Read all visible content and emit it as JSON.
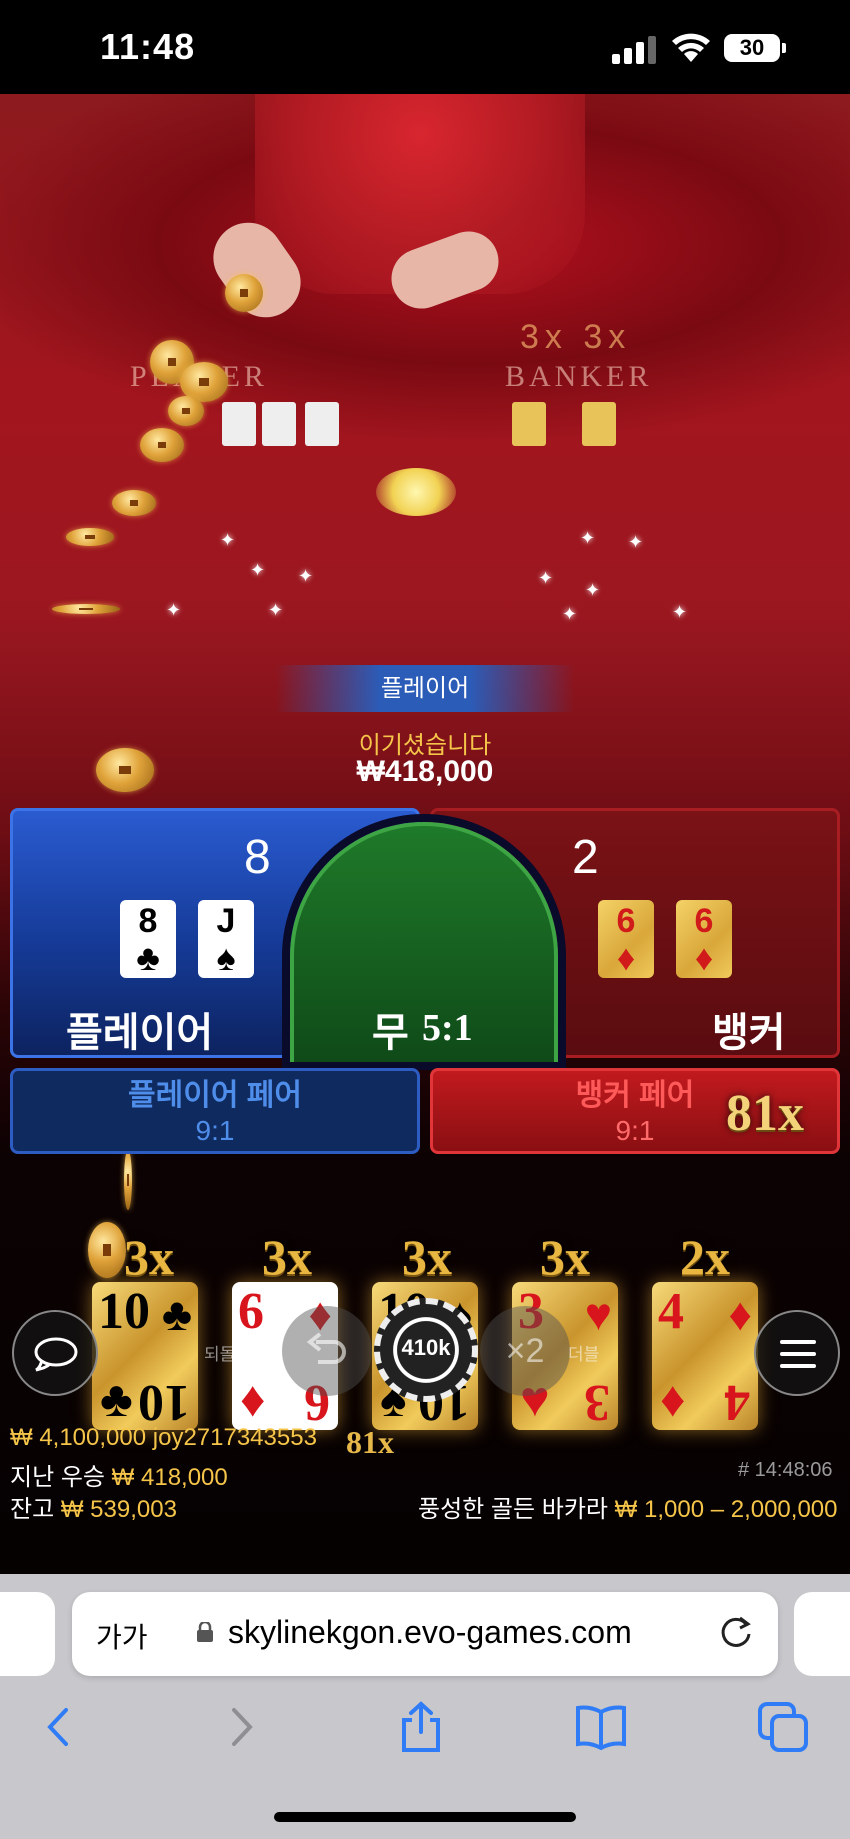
{
  "status_bar": {
    "time": "11:48",
    "battery": "30"
  },
  "table": {
    "player_text": "PLAYER",
    "banker_text": "BANKER",
    "multipliers": "3x 3x"
  },
  "result": {
    "winner": "플레이어",
    "message": "이기셨습니다",
    "amount": "₩418,000"
  },
  "board": {
    "player": {
      "label": "플레이어",
      "score": "8",
      "cards": [
        {
          "rank": "8",
          "suit": "♣"
        },
        {
          "rank": "J",
          "suit": "♠"
        }
      ]
    },
    "banker": {
      "label": "뱅커",
      "score": "2",
      "cards": [
        {
          "rank": "6",
          "suit": "♦"
        },
        {
          "rank": "6",
          "suit": "♦"
        }
      ]
    },
    "tie": {
      "label": "무",
      "odds": "5:1"
    },
    "player_pair": {
      "label": "플레이어 페어",
      "odds": "9:1"
    },
    "banker_pair": {
      "label": "뱅커 페어",
      "odds": "9:1",
      "multiplier": "81x"
    }
  },
  "golden_cards": [
    {
      "multiplier": "3x",
      "rank": "10",
      "suit": "♣",
      "color": "black",
      "style": "gold"
    },
    {
      "multiplier": "3x",
      "rank": "6",
      "suit": "♦",
      "color": "red",
      "style": "white"
    },
    {
      "multiplier": "3x",
      "rank": "10",
      "suit": "♠",
      "color": "black",
      "style": "gold"
    },
    {
      "multiplier": "3x",
      "rank": "3",
      "suit": "♥",
      "color": "red",
      "style": "gold"
    },
    {
      "multiplier": "2x",
      "rank": "4",
      "suit": "♦",
      "color": "red",
      "style": "gold"
    }
  ],
  "controls": {
    "undo_label": "되돌리기",
    "chip_value": "410k",
    "double_label": "더블",
    "double_text": "×2"
  },
  "info": {
    "top_winner": "₩ 4,100,000 joy2717343553",
    "top_winner_multiplier": "81x",
    "last_win_label": "지난 우승",
    "last_win_value": "₩ 418,000",
    "balance_label": "잔고",
    "balance_value": "₩ 539,003",
    "round_id": "# 14:48:06",
    "table_name": "풍성한 골든 바카라",
    "table_limits": "₩ 1,000 – 2,000,000"
  },
  "browser": {
    "aa_label": "가가",
    "url": "skylinekgon.evo-games.com"
  },
  "colors": {
    "player_blue": "#2a5bd0",
    "banker_red": "#7a1216",
    "tie_green": "#1f7a2a",
    "gold": "#f5c54a"
  }
}
